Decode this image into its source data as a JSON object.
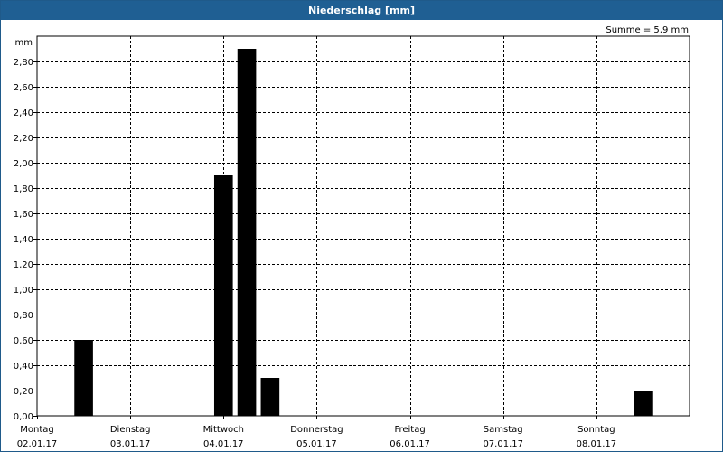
{
  "chart_data": {
    "type": "bar",
    "title": "Niederschlag [mm]",
    "ylabel": "mm",
    "summary": "Summe = 5,9 mm",
    "ylim": [
      0,
      3.0
    ],
    "yticks": [
      "0,00",
      "0,20",
      "0,40",
      "0,60",
      "0,80",
      "1,00",
      "1,20",
      "1,40",
      "1,60",
      "1,80",
      "2,00",
      "2,20",
      "2,40",
      "2,60",
      "2,80"
    ],
    "days": [
      {
        "weekday": "Montag",
        "date": "02.01.17"
      },
      {
        "weekday": "Dienstag",
        "date": "03.01.17"
      },
      {
        "weekday": "Mittwoch",
        "date": "04.01.17"
      },
      {
        "weekday": "Donnerstag",
        "date": "05.01.17"
      },
      {
        "weekday": "Freitag",
        "date": "06.01.17"
      },
      {
        "weekday": "Samstag",
        "date": "07.01.17"
      },
      {
        "weekday": "Sonntag",
        "date": "08.01.17"
      }
    ],
    "bars": [
      {
        "day": "Montag",
        "hour": 12,
        "value": 0.6
      },
      {
        "day": "Mittwoch",
        "hour": 0,
        "value": 1.9
      },
      {
        "day": "Mittwoch",
        "hour": 6,
        "value": 2.9
      },
      {
        "day": "Mittwoch",
        "hour": 12,
        "value": 0.3
      },
      {
        "day": "Sonntag",
        "hour": 12,
        "value": 0.2
      }
    ],
    "grid": true,
    "colors": {
      "bar": "#000000",
      "titlebar": "#1f5f93"
    }
  }
}
